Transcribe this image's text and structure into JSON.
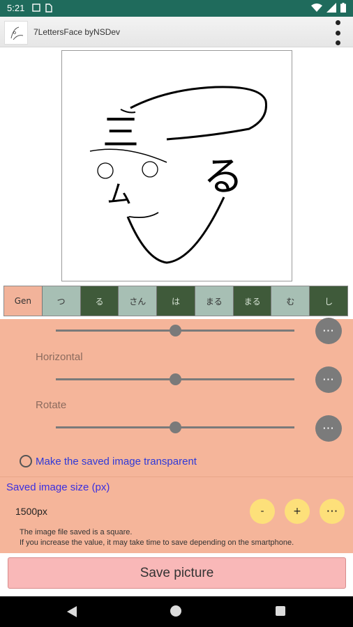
{
  "status_bar": {
    "time": "5:21"
  },
  "app_bar": {
    "title": "7LettersFace byNSDev"
  },
  "face": {
    "glyphs": {
      "eyebrow": "三",
      "ear": "る",
      "nose": "ム"
    }
  },
  "tabs": [
    {
      "label": "Gen",
      "style": "gen"
    },
    {
      "label": "つ",
      "style": "light"
    },
    {
      "label": "る",
      "style": "dark"
    },
    {
      "label": "さん",
      "style": "light"
    },
    {
      "label": "は",
      "style": "dark"
    },
    {
      "label": "まる",
      "style": "light"
    },
    {
      "label": "まる",
      "style": "dark"
    },
    {
      "label": "む",
      "style": "light"
    },
    {
      "label": "し",
      "style": "dark"
    }
  ],
  "sliders": [
    {
      "label": "",
      "value_fraction": 0.5
    },
    {
      "label": "Horizontal",
      "value_fraction": 0.5
    },
    {
      "label": "Rotate",
      "value_fraction": 0.5
    }
  ],
  "more_button_label": "⋯",
  "transparent_option": {
    "label": "Make the saved image transparent",
    "checked": false
  },
  "image_size": {
    "title": "Saved image size (px)",
    "value": "1500px",
    "minus_label": "-",
    "plus_label": "+",
    "more_label": "⋯",
    "note_line1": "The image file saved is a square.",
    "note_line2": "If you increase the value, it may take time to save depending on the smartphone."
  },
  "save_button": {
    "label": "Save picture"
  },
  "colors": {
    "status_bar": "#1f6b5c",
    "panel": "#f5b59a",
    "tab_gen": "#f2b39a",
    "tab_light": "#a7bfb4",
    "tab_dark": "#3f5a3a",
    "size_button": "#fde07a",
    "save_button": "#f9b8b8",
    "link_blue": "#2f3ad8"
  }
}
